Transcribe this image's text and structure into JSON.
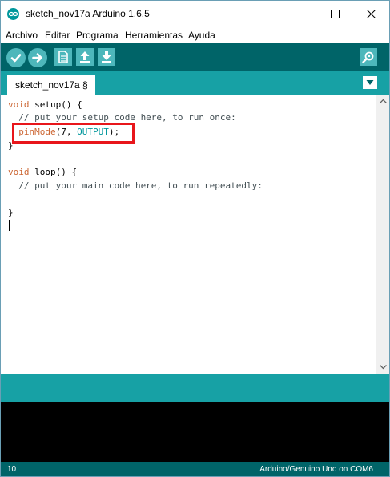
{
  "window": {
    "title": "sketch_nov17a Arduino 1.6.5"
  },
  "menu": {
    "items": [
      "Archivo",
      "Editar",
      "Programa",
      "Herramientas",
      "Ayuda"
    ]
  },
  "toolbar": {
    "icons": [
      "verify-icon",
      "upload-icon",
      "new-icon",
      "open-icon",
      "save-icon",
      "serial-monitor-icon"
    ]
  },
  "tabs": [
    {
      "label": "sketch_nov17a §",
      "active": true
    }
  ],
  "editor": {
    "line1_kw": "void",
    "line1_rest": " setup() {",
    "line2": "  // put your setup code here, to run once:",
    "line3_fn": "pinMode",
    "line3_mid": "(7, ",
    "line3_const": "OUTPUT",
    "line3_end": ");",
    "line4": "}",
    "line6_kw": "void",
    "line6_rest": " loop() {",
    "line7": "  // put your main code here, to run repeatedly:",
    "line9": "}"
  },
  "status": {
    "line_number": "10",
    "board_port": "Arduino/Genuino Uno on COM6"
  },
  "colors": {
    "toolbar": "#006468",
    "tabstrip": "#17a1a5",
    "buttons": "#4db7bb",
    "keyword": "#cc6633",
    "constant": "#00979c",
    "highlight": "#e8161b"
  }
}
